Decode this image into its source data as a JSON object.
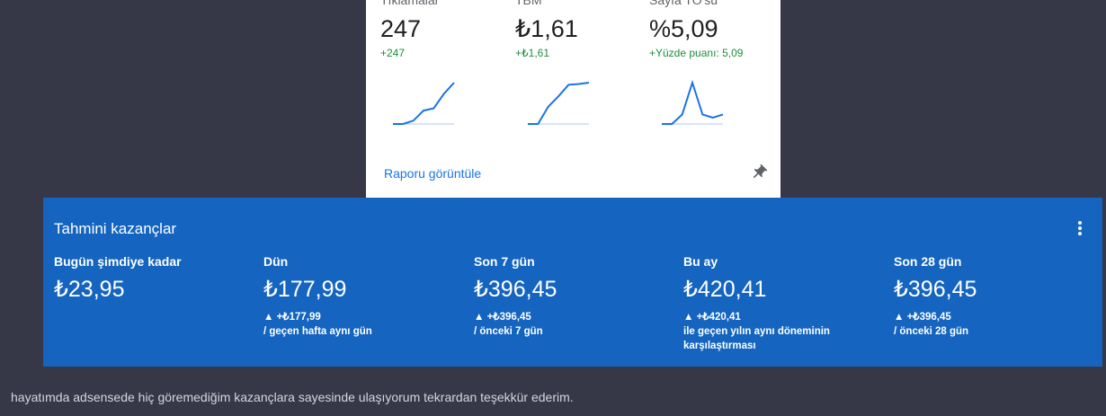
{
  "top_card": {
    "metrics": [
      {
        "label": "Tıklamalar",
        "value": "247",
        "change": "+247",
        "spark": [
          0,
          0,
          3,
          12,
          14,
          27,
          37
        ]
      },
      {
        "label": "TBM",
        "value": "₺1,61",
        "change": "+₺1,61",
        "spark": [
          0,
          0,
          25,
          40,
          57,
          58,
          60
        ]
      },
      {
        "label": "Sayfa TO'su",
        "value": "%5,09",
        "change": "+Yüzde puanı: 5,09",
        "spark": [
          0,
          0,
          12,
          52,
          12,
          8,
          12
        ]
      }
    ],
    "report_link": "Raporu görüntüle",
    "pin_icon": "pin-icon",
    "line_color": "#1a73e8"
  },
  "earnings": {
    "title": "Tahmini kazançlar",
    "menu_icon": "more-vert-icon",
    "columns": [
      {
        "label": "Bugün şimdiye kadar",
        "value": "₺23,95",
        "change": "",
        "compare": ""
      },
      {
        "label": "Dün",
        "value": "₺177,99",
        "change": "▲ +₺177,99",
        "compare": "/ geçen hafta aynı gün"
      },
      {
        "label": "Son 7 gün",
        "value": "₺396,45",
        "change": "▲ +₺396,45",
        "compare": "/ önceki 7 gün"
      },
      {
        "label": "Bu ay",
        "value": "₺420,41",
        "change": "▲ +₺420,41",
        "compare": "ile geçen yılın aynı döneminin karşılaştırması"
      },
      {
        "label": "Son 28 gün",
        "value": "₺396,45",
        "change": "▲ +₺396,45",
        "compare": "/ önceki 28 gün"
      }
    ],
    "bg_color": "#1565c0"
  },
  "comment": "hayatımda adsensede hiç göremediğim kazançlara sayesinde ulaşıyorum tekrardan teşekkür ederim."
}
